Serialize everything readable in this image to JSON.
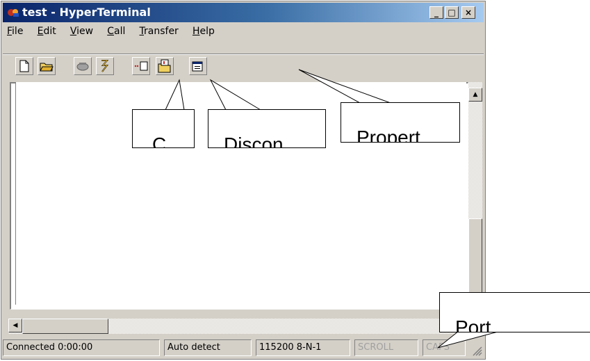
{
  "window": {
    "title": "test - HyperTerminal",
    "controls": [
      "_",
      "□",
      "×"
    ]
  },
  "menu": [
    {
      "key": "F",
      "rest": "ile"
    },
    {
      "key": "E",
      "rest": "dit"
    },
    {
      "key": "V",
      "rest": "iew"
    },
    {
      "key": "C",
      "rest": "all"
    },
    {
      "key": "T",
      "rest": "ransfer"
    },
    {
      "key": "H",
      "rest": "elp"
    }
  ],
  "toolbar": {
    "buttons": [
      "new-document-icon",
      "open-folder-icon",
      "phone-icon",
      "disconnect-phone-icon",
      "send-icon",
      "receive-icon",
      "properties-icon"
    ]
  },
  "status": {
    "connection": "Connected 0:00:00",
    "detect": "Auto detect",
    "port_settings": "115200 8-N-1",
    "scroll": "SCROLL",
    "caps": "CAPS"
  },
  "callouts": {
    "connect": "C",
    "disconnect": "Discon",
    "properties": "Propert",
    "port": "Port"
  },
  "colors": {
    "title_start": "#0a246a",
    "title_end": "#a6caf0",
    "chrome": "#d4d0c8"
  }
}
